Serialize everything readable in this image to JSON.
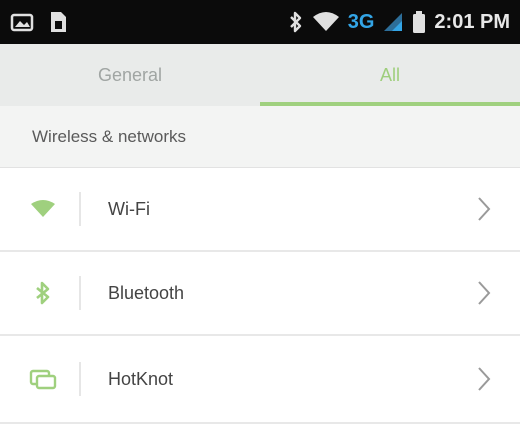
{
  "status_bar": {
    "network_type": "3G",
    "time": "2:01 PM",
    "icons": [
      "image-icon",
      "sim-icon",
      "bluetooth-icon",
      "wifi-icon",
      "signal-icon",
      "battery-icon"
    ]
  },
  "tabs": [
    {
      "label": "General",
      "active": false
    },
    {
      "label": "All",
      "active": true
    }
  ],
  "section": {
    "title": "Wireless & networks"
  },
  "settings": [
    {
      "label": "Wi-Fi",
      "icon": "wifi-icon"
    },
    {
      "label": "Bluetooth",
      "icon": "bluetooth-icon"
    },
    {
      "label": "HotKnot",
      "icon": "hotknot-icon"
    }
  ],
  "colors": {
    "accent": "#9fd07e",
    "status_bar_bg": "#0b0b0b",
    "tab_bg": "#e9ebea",
    "network_label": "#33a5e6"
  }
}
